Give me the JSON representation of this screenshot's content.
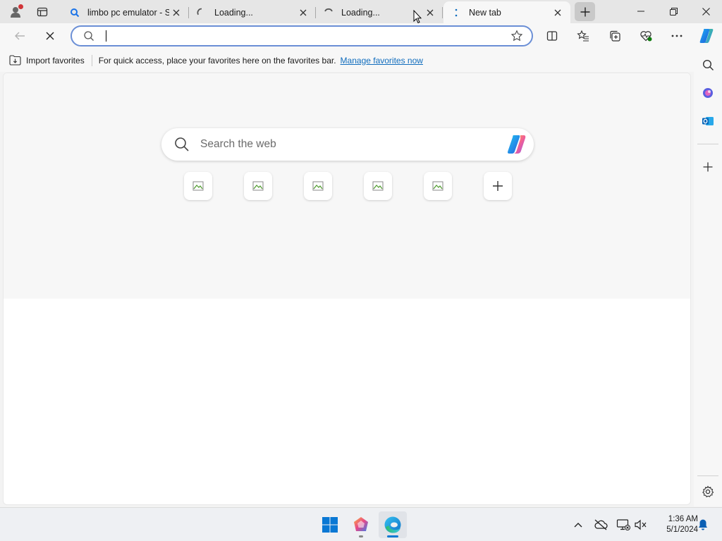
{
  "tabs": [
    {
      "title": "limbo pc emulator - Search",
      "favicon": "search-favicon",
      "state": "inactive"
    },
    {
      "title": "Loading...",
      "favicon": "loading-spinner",
      "state": "inactive"
    },
    {
      "title": "Loading...",
      "favicon": "loading-spinner",
      "state": "inactive"
    },
    {
      "title": "New tab",
      "favicon": "loading-dots",
      "state": "active"
    }
  ],
  "address_bar": {
    "value": "",
    "placeholder": ""
  },
  "favorites_bar": {
    "import_label": "Import favorites",
    "message": "For quick access, place your favorites here on the favorites bar.",
    "link_label": "Manage favorites now"
  },
  "new_tab_page": {
    "search_placeholder": "Search the web",
    "quick_links_count": 5,
    "add_shortcut_icon": "plus-icon"
  },
  "taskbar": {
    "time": "1:36 AM",
    "date": "5/1/2024",
    "apps": [
      "windows-start-icon",
      "copilot-app-icon",
      "edge-browser-icon"
    ]
  },
  "colors": {
    "accent": "#0f6cbd",
    "address_border": "#6b8fd6",
    "tab_strip": "#e6e6e6",
    "toolbar": "#f7f7f7",
    "profile_badge": "#d13438"
  }
}
